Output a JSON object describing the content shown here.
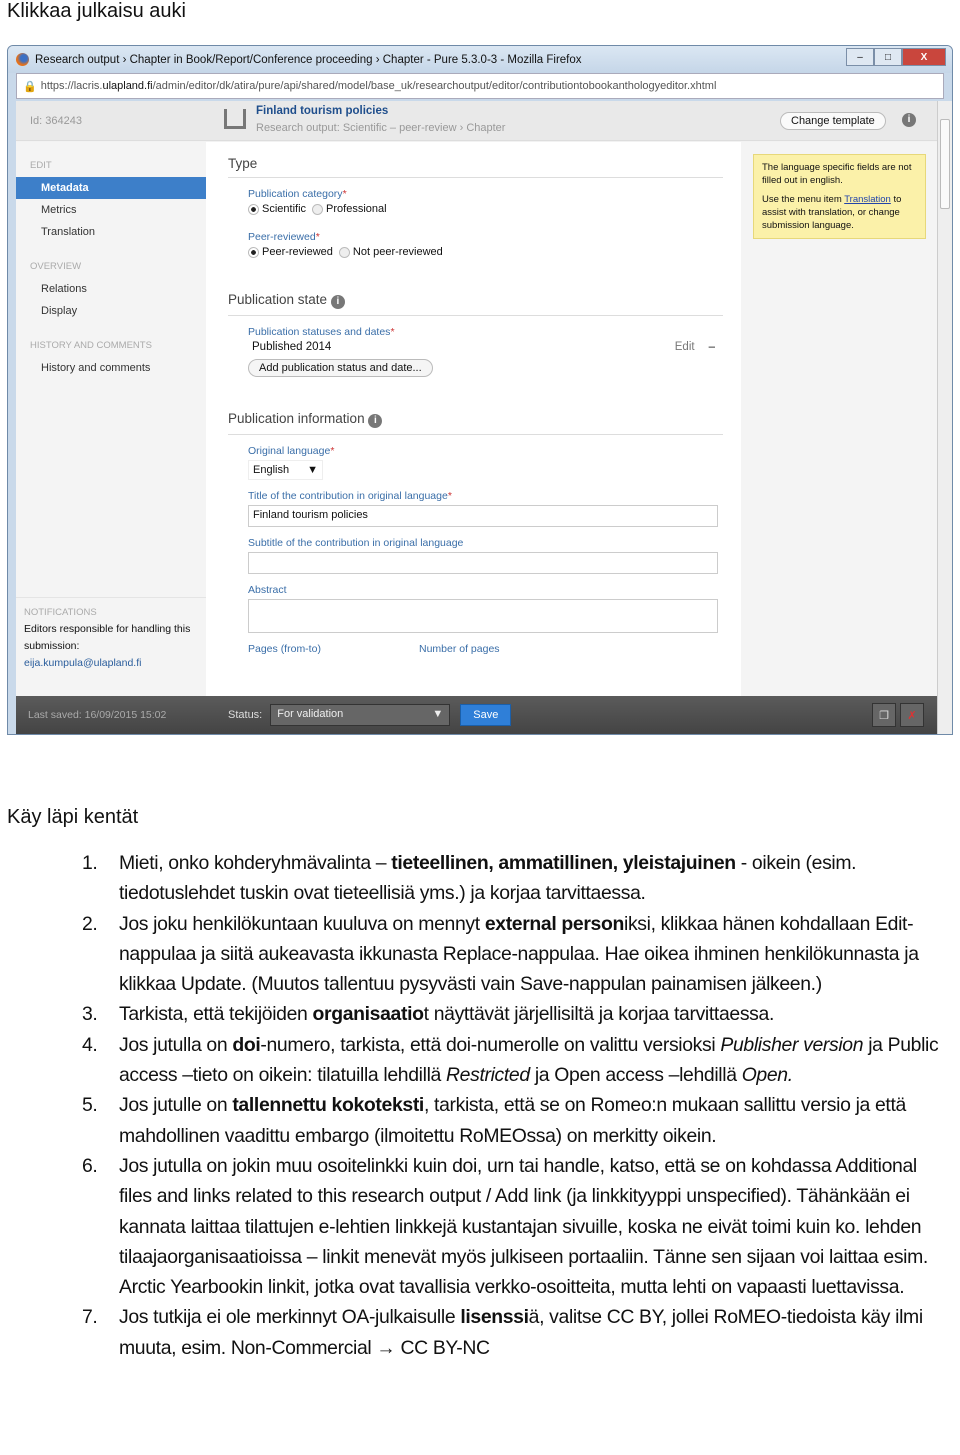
{
  "heading1": "Klikkaa julkaisu auki",
  "heading2": "Käy läpi kentät",
  "window": {
    "title": "Research output › Chapter in Book/Report/Conference proceeding › Chapter - Pure 5.3.0-3 - Mozilla Firefox",
    "url_prefix": "https://lacris.",
    "url_domain": "ulapland.fi",
    "url_path": "/admin/editor/dk/atira/pure/api/shared/model/base_uk/researchoutput/editor/contributiontobookanthologyeditor.xhtml",
    "id": "Id: 364243",
    "pub_title": "Finland tourism policies",
    "pub_subtitle": "Research output: Scientific – peer-review › Chapter",
    "change_template": "Change template",
    "sidebar": {
      "edit": "EDIT",
      "metadata": "Metadata",
      "metrics": "Metrics",
      "translation": "Translation",
      "overview": "OVERVIEW",
      "relations": "Relations",
      "display": "Display",
      "history_sec": "HISTORY AND COMMENTS",
      "history": "History and comments",
      "notifications": "NOTIFICATIONS",
      "notif_text": "Editors responsible for handling this submission:",
      "notif_email": "eija.kumpula@ulapland.fi"
    },
    "main": {
      "type": "Type",
      "pub_category": "Publication category",
      "scientific": "Scientific",
      "professional": "Professional",
      "peer": "Peer-reviewed",
      "peer_yes": "Peer-reviewed",
      "peer_no": "Not peer-reviewed",
      "pub_state": "Publication state",
      "statuses": "Publication statuses and dates",
      "published": "Published 2014",
      "edit": "Edit",
      "minus": "–",
      "add_status": "Add publication status and date...",
      "pub_info": "Publication information",
      "orig_lang": "Original language",
      "lang_value": "English",
      "title_label": "Title of the contribution in original language",
      "title_value": "Finland tourism policies",
      "subtitle_label": "Subtitle of the contribution in original language",
      "subtitle_value": "",
      "abstract": "Abstract",
      "pages": "Pages (from-to)",
      "num_pages": "Number of pages",
      "req": "*"
    },
    "note": {
      "p1": "The language specific fields are not filled out in english.",
      "p2a": "Use the menu item ",
      "link": "Translation",
      "p2b": " to assist with translation, or change submission language."
    },
    "bottom": {
      "last_saved": "Last saved: 16/09/2015 15:02",
      "status_label": "Status:",
      "status_value": "For validation",
      "save": "Save"
    }
  },
  "list": [
    [
      {
        "t": "Mieti, onko kohderyhmävalinta – "
      },
      {
        "t": "tieteellinen, ammatillinen, yleistajuinen",
        "b": true
      },
      {
        "t": " - oikein (esim. tiedotuslehdet tuskin ovat tieteellisiä yms.)  ja korjaa tarvittaessa."
      }
    ],
    [
      {
        "t": "Jos joku henkilökuntaan kuuluva on mennyt "
      },
      {
        "t": "external person",
        "b": true
      },
      {
        "t": "iksi, klikkaa hänen kohdallaan Edit-nappulaa ja siitä aukeavasta ikkunasta Replace-nappulaa. Hae oikea ihminen henkilökunnasta ja klikkaa Update. (Muutos tallentuu pysyvästi vain Save-nappulan painamisen jälkeen.)"
      }
    ],
    [
      {
        "t": "Tarkista, että tekijöiden "
      },
      {
        "t": "organisaatio",
        "b": true
      },
      {
        "t": "t näyttävät järjellisiltä ja korjaa tarvittaessa."
      }
    ],
    [
      {
        "t": "Jos jutulla on "
      },
      {
        "t": "doi",
        "b": true
      },
      {
        "t": "-numero, tarkista, että doi-numerolle on valittu versioksi "
      },
      {
        "t": "Publisher version",
        "i": true
      },
      {
        "t": " ja Public access –tieto on oikein: tilatuilla lehdillä "
      },
      {
        "t": "Restricted",
        "i": true
      },
      {
        "t": " ja Open access –lehdillä "
      },
      {
        "t": "Open.",
        "i": true
      }
    ],
    [
      {
        "t": "Jos jutulle on "
      },
      {
        "t": "tallennettu kokoteksti",
        "b": true
      },
      {
        "t": ", tarkista, että se on Romeo:n mukaan sallittu versio ja että mahdollinen vaadittu embargo (ilmoitettu RoMEOssa) on merkitty oikein."
      }
    ],
    [
      {
        "t": "Jos jutulla on jokin muu osoitelinkki kuin doi, urn tai handle, katso, että se on kohdassa Additional files and links related to this research output / Add link (ja linkkityyppi unspecified). Tähänkään ei kannata laittaa tilattujen e-lehtien linkkejä kustantajan sivuille, koska ne eivät toimi kuin ko. lehden tilaajaorganisaatioissa – linkit menevät myös julkiseen portaaliin. Tänne sen sijaan voi laittaa esim. Arctic Yearbookin linkit, jotka ovat tavallisia verkko-osoitteita, mutta lehti on vapaasti luettavissa."
      }
    ],
    [
      {
        "t": "Jos tutkija ei ole merkinnyt OA-julkaisulle "
      },
      {
        "t": "lisenssi",
        "b": true
      },
      {
        "t": "ä, valitse CC BY, jollei RoMEO-tiedoista käy ilmi muuta, esim. Non-Commercial → CC BY-NC"
      }
    ]
  ]
}
